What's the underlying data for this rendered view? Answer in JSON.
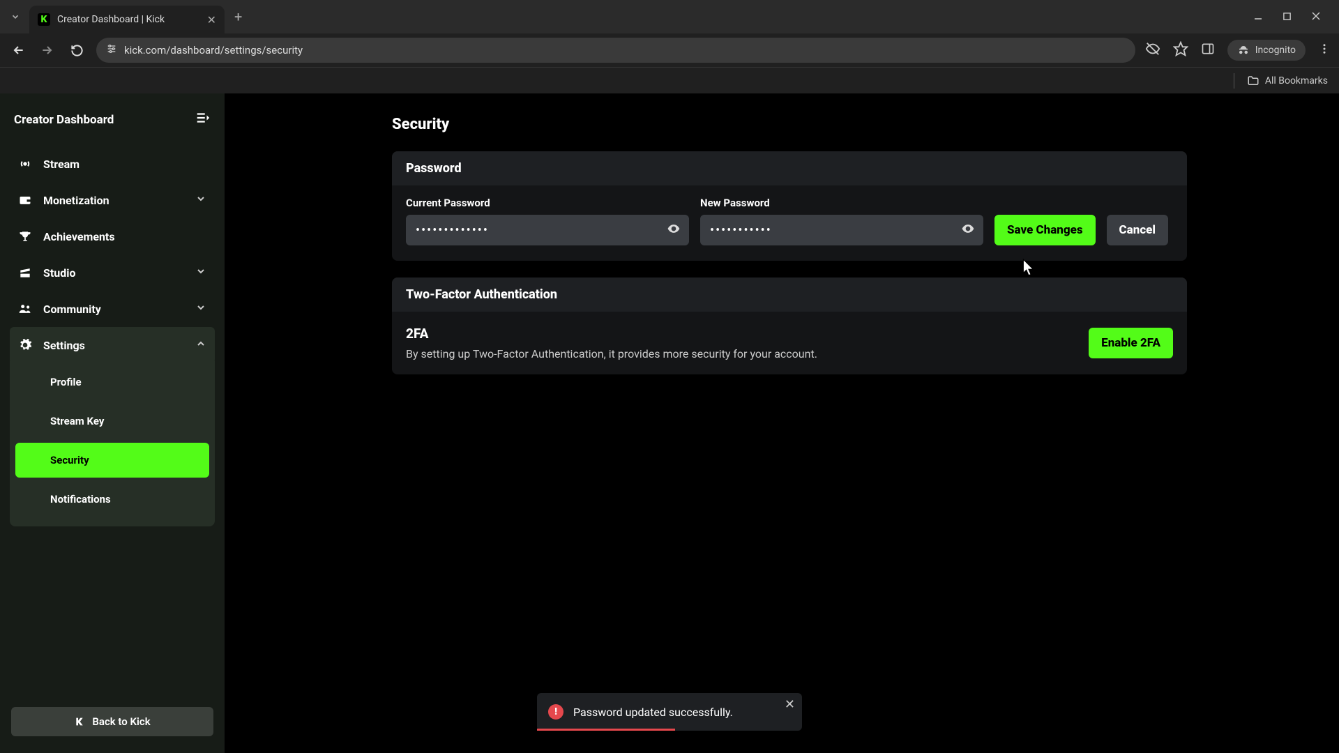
{
  "browser": {
    "tab_title": "Creator Dashboard | Kick",
    "url": "kick.com/dashboard/settings/security",
    "incognito_label": "Incognito",
    "all_bookmarks": "All Bookmarks"
  },
  "sidebar": {
    "title": "Creator Dashboard",
    "items": [
      {
        "label": "Stream"
      },
      {
        "label": "Monetization"
      },
      {
        "label": "Achievements"
      },
      {
        "label": "Studio"
      },
      {
        "label": "Community"
      },
      {
        "label": "Settings"
      }
    ],
    "settings_children": [
      {
        "label": "Profile"
      },
      {
        "label": "Stream Key"
      },
      {
        "label": "Security"
      },
      {
        "label": "Notifications"
      }
    ],
    "back_label": "Back to Kick"
  },
  "page": {
    "title": "Security",
    "password_section": {
      "header": "Password",
      "current_label": "Current Password",
      "current_value": "•••••••••••••",
      "new_label": "New Password",
      "new_value": "•••••••••••",
      "save_label": "Save Changes",
      "cancel_label": "Cancel"
    },
    "tfa_section": {
      "header": "Two-Factor Authentication",
      "title": "2FA",
      "description": "By setting up Two-Factor Authentication, it provides more security for your account.",
      "enable_label": "Enable 2FA"
    }
  },
  "toast": {
    "message": "Password updated successfully."
  }
}
